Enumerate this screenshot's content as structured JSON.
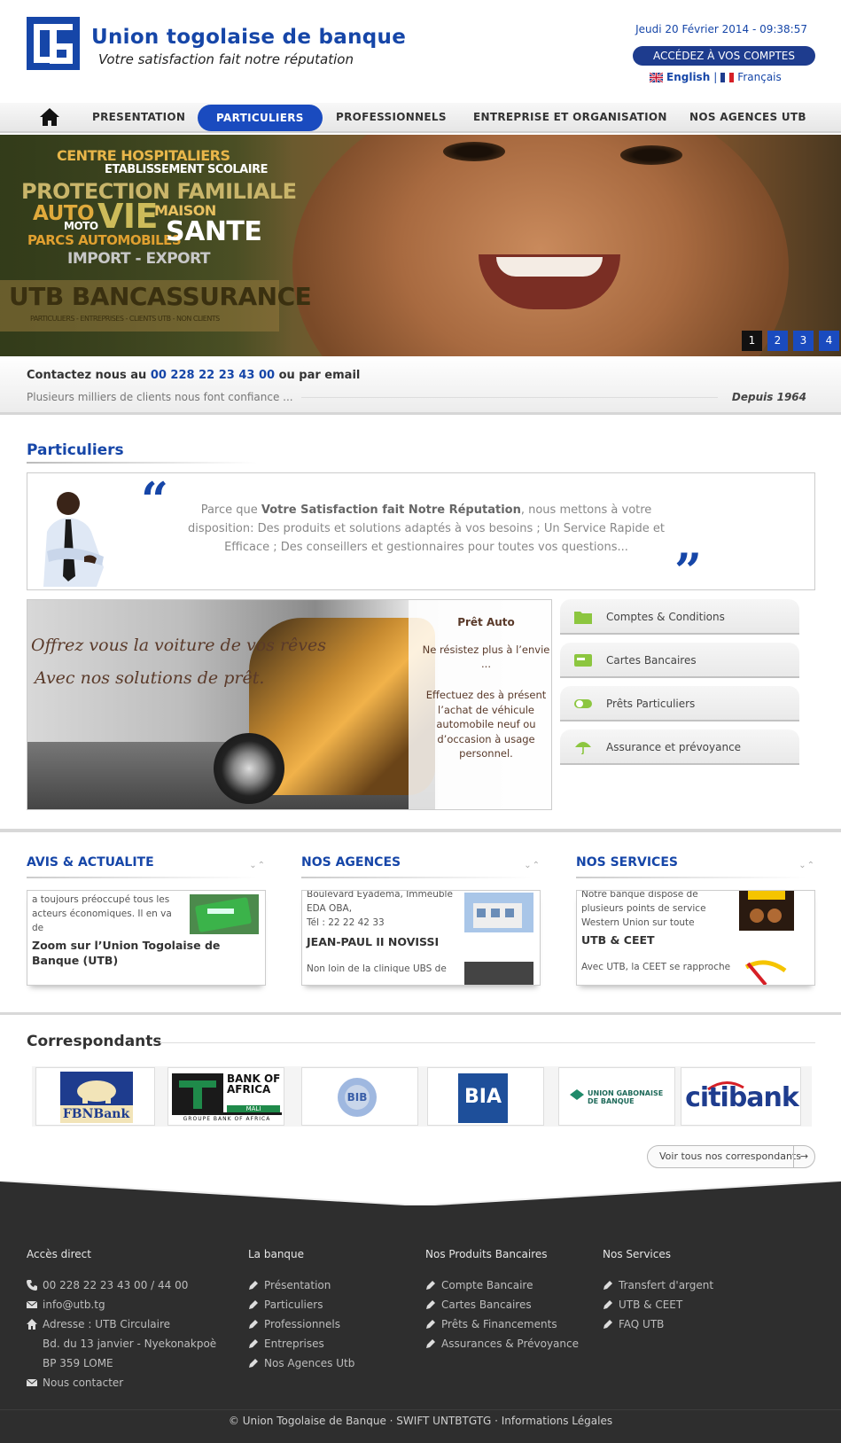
{
  "header": {
    "brand": "Union togolaise de banque",
    "slogan": "Votre satisfaction fait notre réputation",
    "date": "Jeudi 20 Février 2014 - 09:38:57",
    "access_button": "ACCÉDEZ À VOS COMPTES",
    "lang_en": "English",
    "lang_sep": "|",
    "lang_fr": "Français",
    "brand_color": "#1646a8"
  },
  "nav": {
    "home_icon": "home-icon",
    "items": [
      {
        "label": "PRESENTATION"
      },
      {
        "label": "PARTICULIERS",
        "active": true
      },
      {
        "label": "PROFESSIONNELS"
      },
      {
        "label": "ENTREPRISE ET ORGANISATION"
      },
      {
        "label": "NOS AGENCES UTB"
      }
    ]
  },
  "banner": {
    "words": [
      "CENTRE HOSPITALIERS",
      "ETABLISSEMENT SCOLAIRE",
      "PROTECTION FAMILIALE",
      "AUTO",
      "VIE",
      "MAISON",
      "MOTO",
      "PARCS AUTOMOBILES",
      "SANTE",
      "IMPORT - EXPORT",
      "UTB BANCASSURANCE",
      "PARTICULIERS - ENTREPRISES - CLIENTS UTB - NON CLIENTS"
    ],
    "slides": [
      "1",
      "2",
      "3",
      "4"
    ],
    "active_slide": "1"
  },
  "contact": {
    "prefix": "Contactez nous au",
    "phone": "00 228 22 23 43 00",
    "suffix": "ou par email",
    "subline": "Plusieurs milliers de clients nous font confiance ...",
    "since": "Depuis 1964"
  },
  "particuliers": {
    "title": "Particuliers",
    "quote_open": "“",
    "quote_close": "”",
    "quote_before": "Parce que",
    "quote_bold": "Votre Satisfaction fait Notre Réputation",
    "quote_after": ", nous mettons à votre disposition: Des produits et solutions adaptés à vos besoins ; Un Service Rapide et Efficace ; Des conseillers et gestionnaires pour toutes vos questions...",
    "promo": {
      "headline1": "Offrez vous la voiture de vos rêves",
      "headline2": "Avec nos solutions de prêt.",
      "title": "Prêt Auto",
      "line1": "Ne résistez plus à l’envie ...",
      "line2": "Effectuez des à présent l’achat de véhicule automobile neuf ou d’occasion à usage personnel."
    },
    "tabs": [
      {
        "label": "Comptes & Conditions",
        "icon": "folder-icon"
      },
      {
        "label": "Cartes Bancaires",
        "icon": "card-icon"
      },
      {
        "label": "Prêts Particuliers",
        "icon": "toggle-icon"
      },
      {
        "label": "Assurance et prévoyance",
        "icon": "umbrella-icon"
      }
    ]
  },
  "columns": [
    {
      "title": "AVIS & ACTUALITE",
      "text1": "a toujours préoccupé tous les acteurs économiques. Il en va de",
      "headline": "Zoom sur l’Union Togolaise de Banque (UTB)"
    },
    {
      "title": "NOS AGENCES",
      "text1": "Boulevard Eyadema, Immeuble EDA OBA,",
      "text2": "Tél : 22 22 42 33",
      "headline": "JEAN-PAUL II NOVISSI",
      "text3": "Non loin de la clinique UBS de"
    },
    {
      "title": "NOS SERVICES",
      "text1": "Notre banque dispose de plusieurs points de service Western Union sur toute",
      "headline": "UTB & CEET",
      "text2": "Avec UTB, la CEET se rapproche"
    }
  ],
  "correspondants": {
    "title": "Correspondants",
    "logos": [
      {
        "name": "FBNBank",
        "text": "FBNBank"
      },
      {
        "name": "Bank of Africa Mali",
        "text": "BANK OF AFRICA",
        "sub": "MALI",
        "tag": "GROUPE BANK OF AFRICA"
      },
      {
        "name": "BIB",
        "text": "BIB"
      },
      {
        "name": "BIA",
        "text": "BIA"
      },
      {
        "name": "Union Gabonaise de Banque",
        "text": "UNION GABONAISE DE BANQUE"
      },
      {
        "name": "citibank",
        "text": "citibank"
      }
    ],
    "more_button": "Voir tous nos correspondants",
    "more_arrow": "→"
  },
  "footer": {
    "col1": {
      "title": "Accès direct",
      "phone": "00 228 22 23 43 00 / 44 00",
      "email": "info@utb.tg",
      "address1": "Adresse : UTB Circulaire",
      "address2": "Bd. du 13 janvier - Nyekonakpoè",
      "address3": "BP 359 LOME",
      "contact": "Nous contacter"
    },
    "col2": {
      "title": "La banque",
      "items": [
        "Présentation",
        "Particuliers",
        "Professionnels",
        "Entreprises",
        "Nos Agences Utb"
      ]
    },
    "col3": {
      "title": "Nos Produits Bancaires",
      "items": [
        "Compte Bancaire",
        "Cartes Bancaires",
        "Prêts & Financements",
        "Assurances & Prévoyance"
      ]
    },
    "col4": {
      "title": "Nos Services",
      "items": [
        "Transfert d'argent",
        "UTB & CEET",
        "FAQ UTB"
      ]
    },
    "copyright": "© Union Togolaise de Banque · SWIFT UNTBTGTG · Informations Légales"
  }
}
